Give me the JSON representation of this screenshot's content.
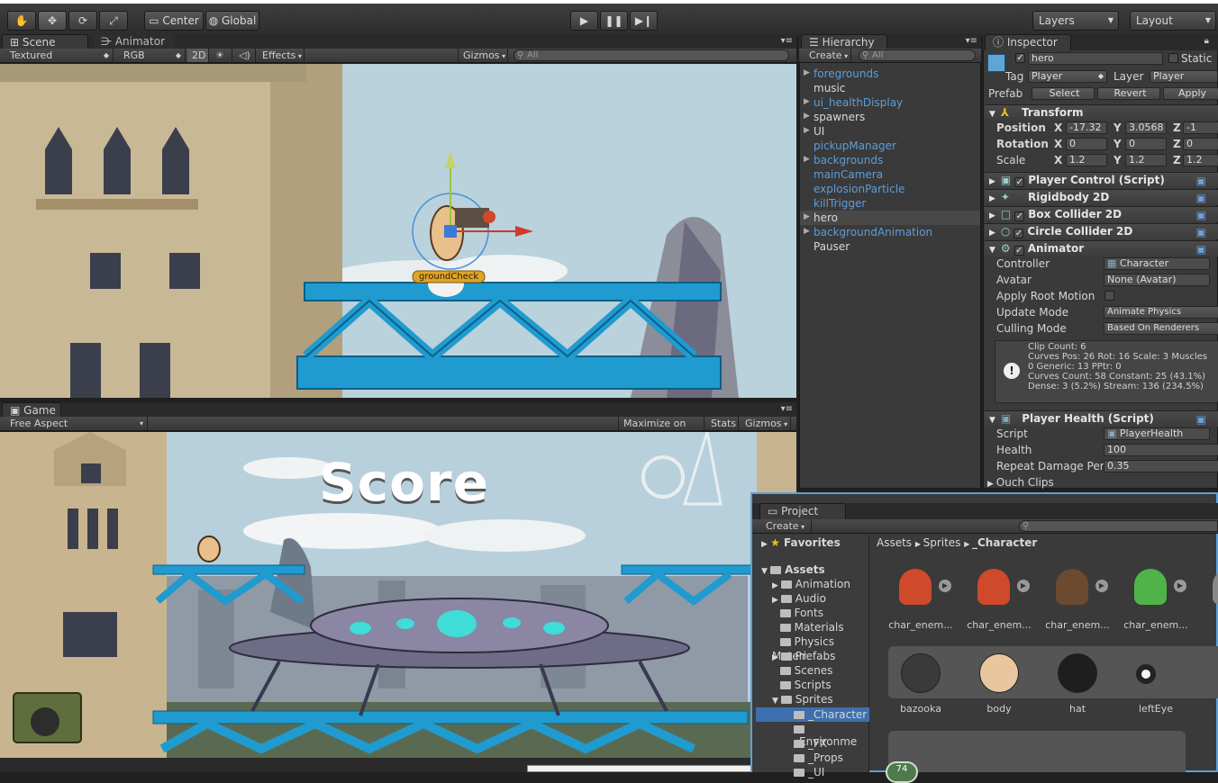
{
  "toolbar": {
    "tools": [
      "hand-icon",
      "move-icon",
      "rotate-icon",
      "scale-icon"
    ],
    "pivot_label": "Center",
    "space_label": "Global",
    "layers_label": "Layers",
    "layout_label": "Layout"
  },
  "scene": {
    "tab_label": "Scene",
    "animator_tab_label": "Animator",
    "shading": "Textured",
    "render_mode": "RGB",
    "mode_2d": "2D",
    "effects": "Effects",
    "gizmos": "Gizmos",
    "search_placeholder": "All",
    "ground_check_label": "groundCheck"
  },
  "game": {
    "tab_label": "Game",
    "aspect": "Free Aspect",
    "maximize": "Maximize on Play",
    "stats": "Stats",
    "gizmos": "Gizmos",
    "score_text": "Score"
  },
  "hierarchy": {
    "tab_label": "Hierarchy",
    "create_label": "Create",
    "search_placeholder": "All",
    "items": [
      {
        "label": "foregrounds",
        "prefab": true,
        "expandable": true
      },
      {
        "label": "music",
        "prefab": false,
        "expandable": false
      },
      {
        "label": "ui_healthDisplay",
        "prefab": true,
        "expandable": true
      },
      {
        "label": "spawners",
        "prefab": false,
        "expandable": true
      },
      {
        "label": "UI",
        "prefab": false,
        "expandable": true
      },
      {
        "label": "pickupManager",
        "prefab": true,
        "expandable": false
      },
      {
        "label": "backgrounds",
        "prefab": true,
        "expandable": true
      },
      {
        "label": "mainCamera",
        "prefab": true,
        "expandable": false
      },
      {
        "label": "explosionParticle",
        "prefab": true,
        "expandable": false
      },
      {
        "label": "killTrigger",
        "prefab": true,
        "expandable": false
      },
      {
        "label": "hero",
        "prefab": false,
        "expandable": true,
        "selected": true
      },
      {
        "label": "backgroundAnimation",
        "prefab": true,
        "expandable": true
      },
      {
        "label": "Pauser",
        "prefab": false,
        "expandable": false
      }
    ]
  },
  "inspector": {
    "tab_label": "Inspector",
    "object_name": "hero",
    "static_label": "Static",
    "tag_label": "Tag",
    "tag_value": "Player",
    "layer_label": "Layer",
    "layer_value": "Player",
    "prefab_label": "Prefab",
    "prefab_select": "Select",
    "prefab_revert": "Revert",
    "prefab_apply": "Apply",
    "transform": {
      "title": "Transform",
      "position_label": "Position",
      "rotation_label": "Rotation",
      "scale_label": "Scale",
      "position": {
        "x": "-17.32",
        "y": "3.0568",
        "z": "-1"
      },
      "rotation": {
        "x": "0",
        "y": "0",
        "z": "0"
      },
      "scale": {
        "x": "1.2",
        "y": "1.2",
        "z": "1.2"
      }
    },
    "components": [
      "Player Control (Script)",
      "Rigidbody 2D",
      "Box Collider 2D",
      "Circle Collider 2D",
      "Animator"
    ],
    "animator": {
      "controller_label": "Controller",
      "controller_value": "Character",
      "avatar_label": "Avatar",
      "avatar_value": "None (Avatar)",
      "root_motion_label": "Apply Root Motion",
      "update_mode_label": "Update Mode",
      "update_mode_value": "Animate Physics",
      "culling_label": "Culling Mode",
      "culling_value": "Based On Renderers",
      "info_lines": [
        "Clip Count: 6",
        "Curves Pos: 26 Rot: 16 Scale: 3 Muscles",
        "0 Generic: 13 PPtr: 0",
        "Curves Count: 58 Constant: 25 (43.1%)",
        "Dense: 3 (5.2%) Stream: 136 (234.5%)"
      ]
    },
    "player_health": {
      "title": "Player Health (Script)",
      "script_label": "Script",
      "script_value": "PlayerHealth",
      "health_label": "Health",
      "health_value": "100",
      "repeat_label": "Repeat Damage Peri",
      "repeat_value": "0.35",
      "ouch_label": "Ouch Clips"
    }
  },
  "project": {
    "tab_label": "Project",
    "create_label": "Create",
    "favorites": "Favorites",
    "assets": "Assets",
    "breadcrumb": [
      "Assets",
      "Sprites",
      "_Character"
    ],
    "folders": [
      "Animation",
      "Audio",
      "Fonts",
      "Materials",
      "Physics Materi",
      "Prefabs",
      "Scenes",
      "Scripts",
      "Sprites"
    ],
    "subfolders": [
      "_Character",
      "_Environme",
      "_FX",
      "_Props",
      "_UI"
    ],
    "assets_row1": [
      "char_enem...",
      "char_enem...",
      "char_enem...",
      "char_enem...",
      "ch"
    ],
    "assets_row2": [
      "bazooka",
      "body",
      "hat",
      "leftEye"
    ],
    "badge": "74"
  }
}
